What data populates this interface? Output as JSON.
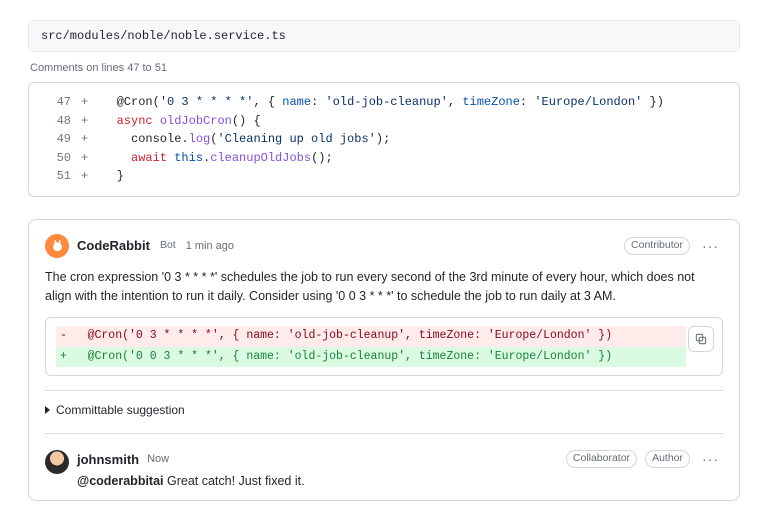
{
  "file_path": "src/modules/noble/noble.service.ts",
  "comment_range": "Comments on lines 47 to 51",
  "code": {
    "lines": [
      {
        "num": "47",
        "marker": "+",
        "html": "<span class='tok-dec'>@Cron</span>(<span class='tok-str'>'0 3 * * * *'</span>, { <span class='tok-prop'>name</span>: <span class='tok-str'>'old-job-cleanup'</span>, <span class='tok-prop'>timeZone</span>: <span class='tok-str'>'Europe/London'</span> })"
      },
      {
        "num": "48",
        "marker": "+",
        "html": "<span class='tok-kw'>async</span> <span class='tok-fn'>oldJobCron</span>() {"
      },
      {
        "num": "49",
        "marker": "+",
        "html": "  console.<span class='tok-fn'>log</span>(<span class='tok-str'>'Cleaning up old jobs'</span>);"
      },
      {
        "num": "50",
        "marker": "+",
        "html": "  <span class='tok-kw'>await</span> <span class='tok-this'>this</span>.<span class='tok-fn'>cleanupOldJobs</span>();"
      },
      {
        "num": "51",
        "marker": "+",
        "html": "}"
      }
    ]
  },
  "review": {
    "author": "CodeRabbit",
    "bot_label": "Bot",
    "timestamp": "1 min ago",
    "role_badge": "Contributor",
    "body": "The cron expression '0 3 * * * *' schedules the job to run every second of the 3rd minute of every hour, which does not align with the intention to run it daily. Consider using '0 0 3 * * *' to schedule the job to run daily at 3 AM.",
    "diff": {
      "del": "-   @Cron('0 3 * * * *', { name: 'old-job-cleanup', timeZone: 'Europe/London' })",
      "add": "+   @Cron('0 0 3 * * *', { name: 'old-job-cleanup', timeZone: 'Europe/London' })"
    },
    "committable_label": "Committable suggestion"
  },
  "reply": {
    "author": "johnsmith",
    "timestamp": "Now",
    "badges": [
      "Collaborator",
      "Author"
    ],
    "mention": "@coderabbitai",
    "text": " Great catch! Just fixed it."
  },
  "icons": {
    "more": "···"
  }
}
